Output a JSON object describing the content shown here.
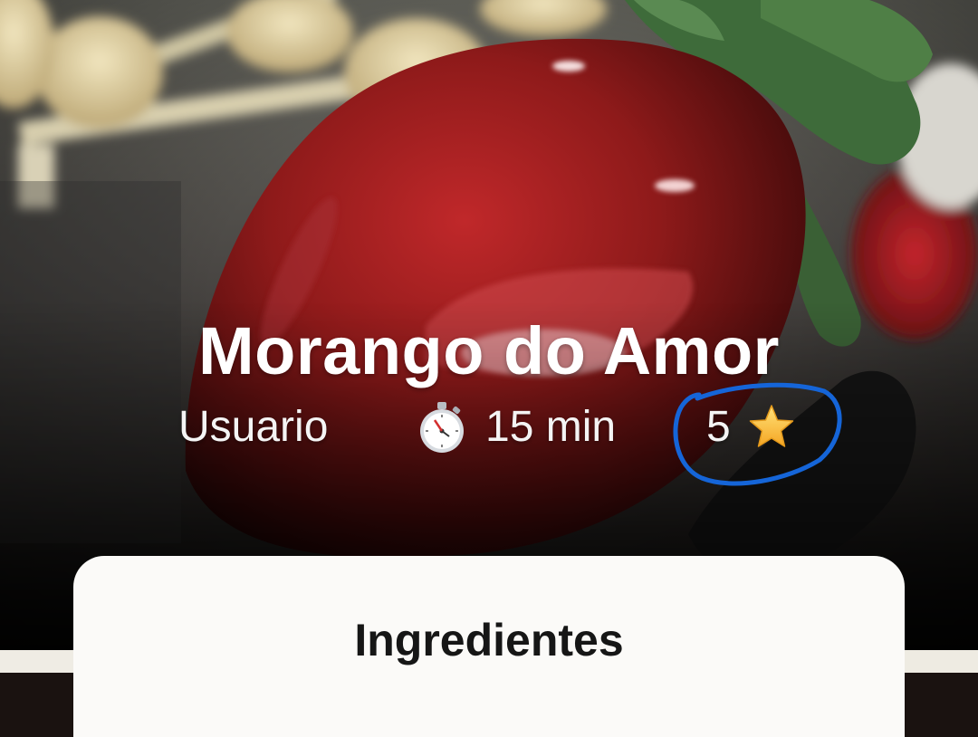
{
  "recipe": {
    "title": "Morango do Amor",
    "author": "Usuario",
    "time": "15 min",
    "rating": "5"
  },
  "icons": {
    "timer": "stopwatch-icon",
    "rating": "star-icon"
  },
  "colors": {
    "title_text": "#ffffff",
    "card_background": "#fbfaf8",
    "annotation_circle": "#1565d8",
    "strawberry_red": "#8e1a1a"
  },
  "card": {
    "heading": "Ingredientes"
  }
}
